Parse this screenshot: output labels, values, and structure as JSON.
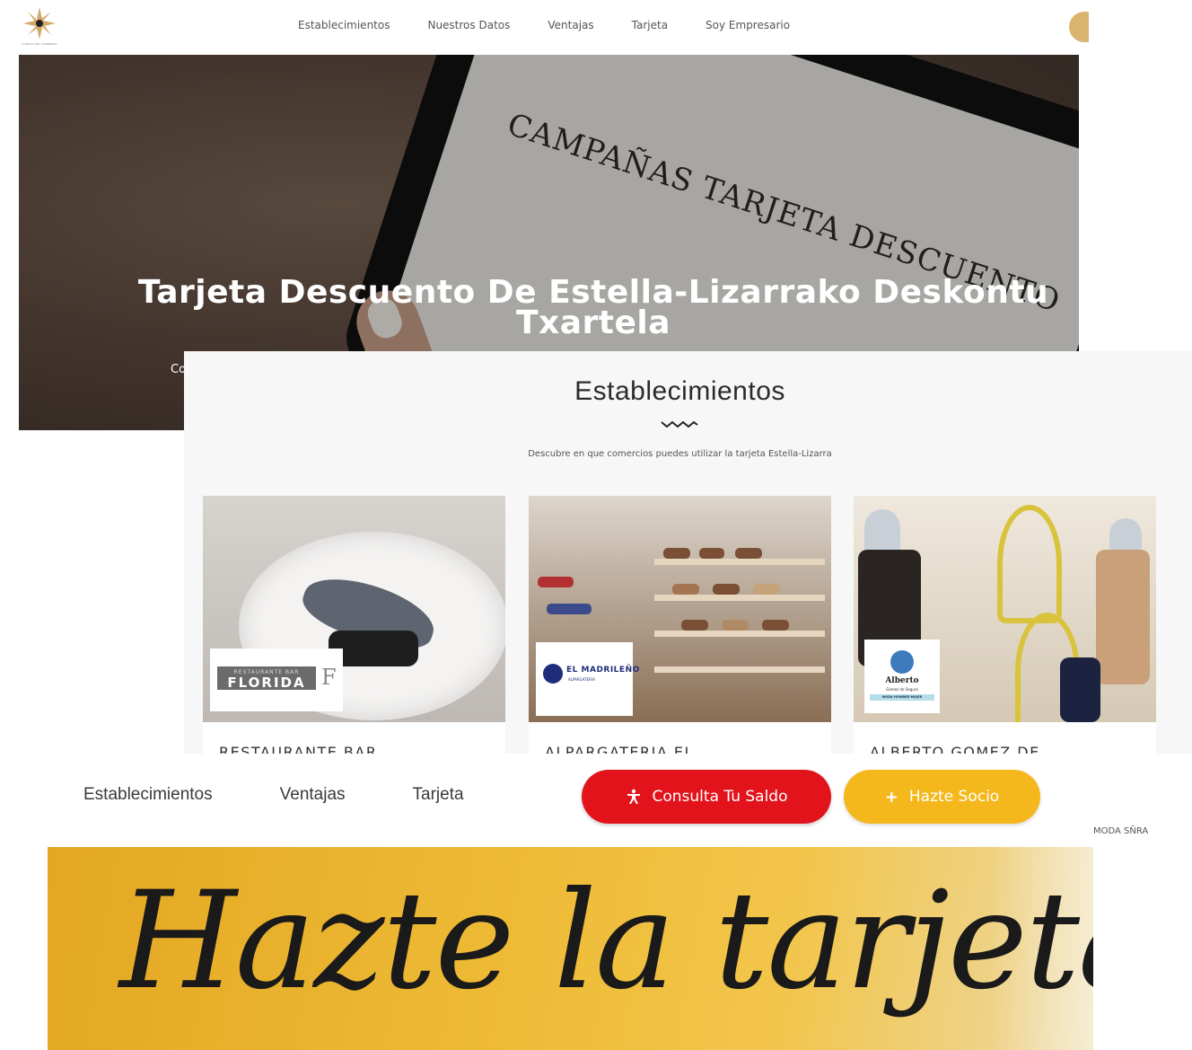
{
  "top_nav": {
    "logo_caption": "CIUDAD DEL COMERCIO",
    "items": [
      "Establecimientos",
      "Nuestros Datos",
      "Ventajas",
      "Tarjeta",
      "Soy Empresario"
    ]
  },
  "hero": {
    "title_line1": "Tarjeta Descuento De Estella-Lizarrako Deskontu",
    "title_line2": "Txartela",
    "subtitle": "Co",
    "tablet_text": "CAMPAÑAS TARJETA DESCUENTO"
  },
  "establecimientos": {
    "title": "Establecimientos",
    "subtitle": "Descubre en que comercios puedes utilizar la tarjeta Estella-Lizarra",
    "cards": [
      {
        "name": "RESTAURANTE BAR",
        "logo_top": "RESTAURANTE BAR",
        "logo_main": "FLORIDA",
        "logo_mark": "F"
      },
      {
        "name": "ALPARGATERIA EL",
        "logo_main": "EL MADRILEÑO",
        "logo_sub": "ALPARGATERIA"
      },
      {
        "name": "ALBERTO GOMEZ DE",
        "logo_main": "Alberto",
        "logo_sub": "Gómez de Segura",
        "logo_strip": "MODA HOMBRE-MUJER"
      }
    ]
  },
  "sticky_nav": {
    "items": [
      "Establecimientos",
      "Ventajas",
      "Tarjeta"
    ],
    "saldo_button": "Consulta Tu Saldo",
    "saldo_icon": "person-icon",
    "socio_button": "Hazte Socio",
    "socio_icon": "plus-icon",
    "overflow_label": "MODA SÑRA"
  },
  "banner": {
    "script_text": "Hazte la tarjeta"
  },
  "colors": {
    "red": "#e3131c",
    "yellow": "#f4b81c",
    "gold": "#d9b570"
  }
}
